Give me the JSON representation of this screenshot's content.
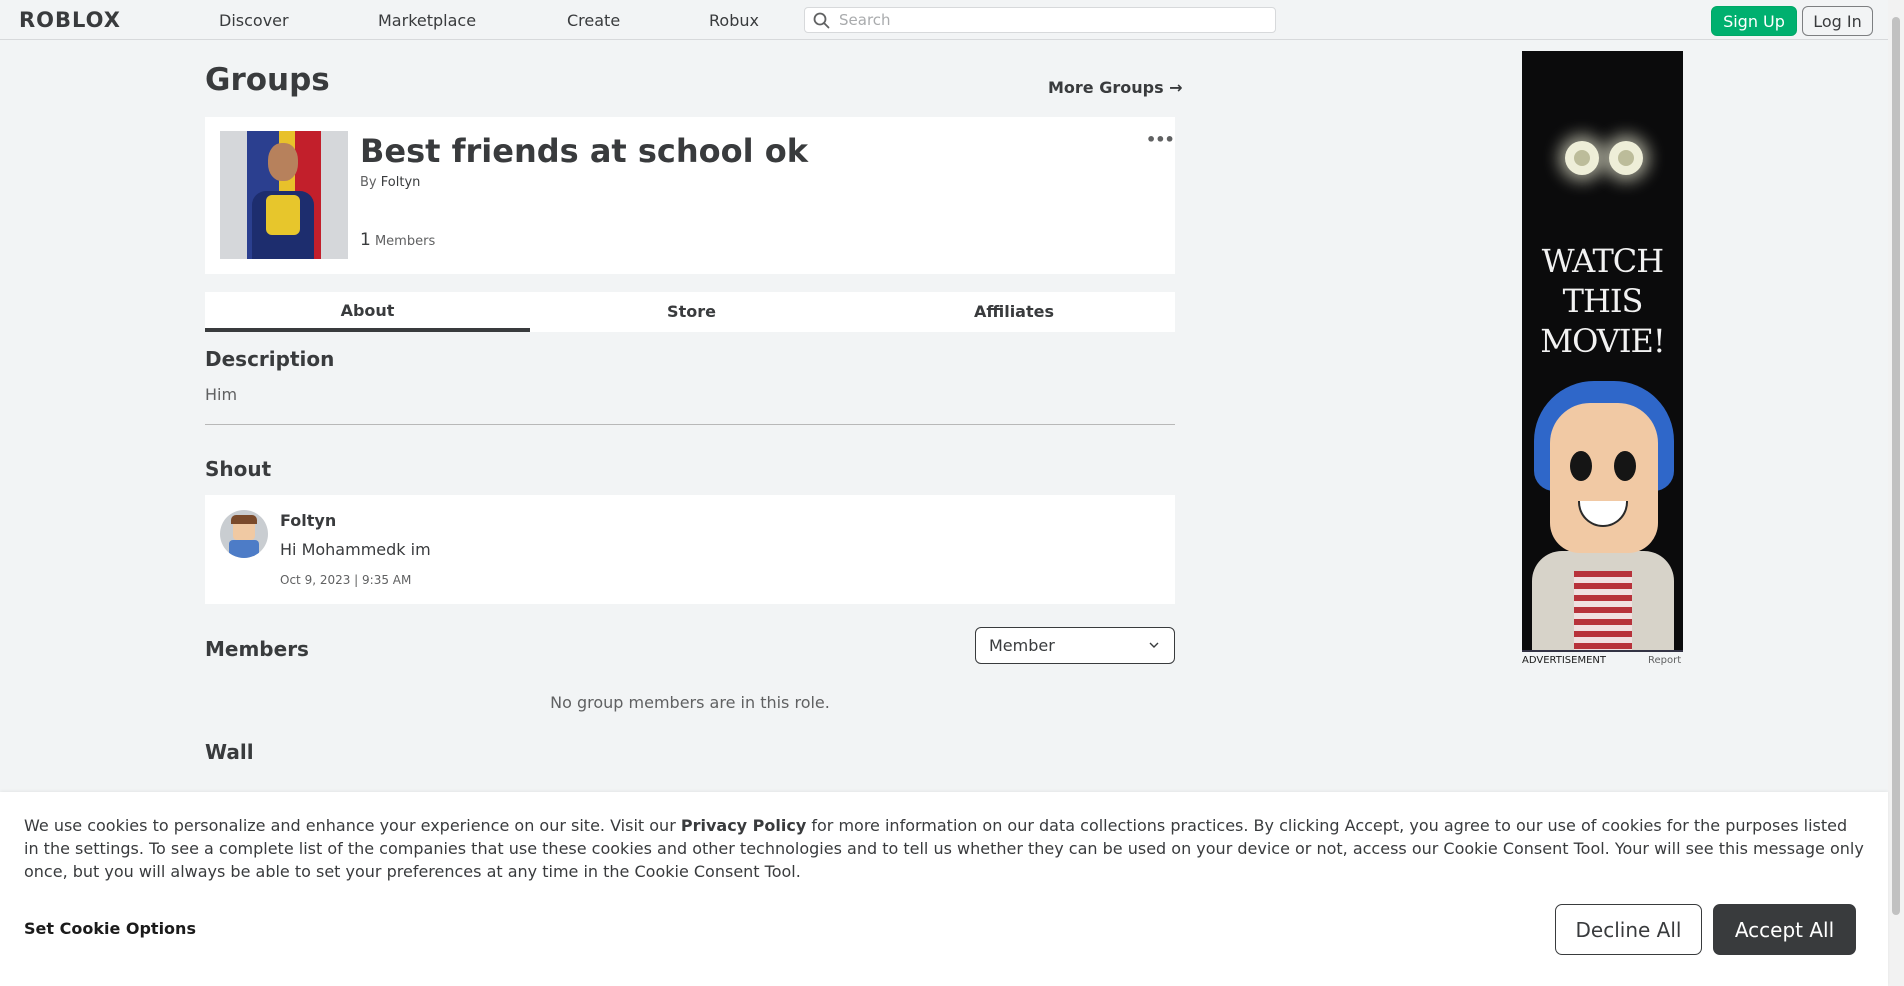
{
  "header": {
    "logo": "ROBLOX",
    "nav": [
      "Discover",
      "Marketplace",
      "Create",
      "Robux"
    ],
    "search_placeholder": "Search",
    "signup_label": "Sign Up",
    "login_label": "Log In"
  },
  "page": {
    "title": "Groups",
    "more_groups": "More Groups →"
  },
  "group": {
    "name": "Best friends at school ok",
    "by_prefix": "By",
    "owner": "Foltyn",
    "member_count": "1",
    "members_label": "Members",
    "more_menu": "•••"
  },
  "tabs": [
    "About",
    "Store",
    "Affiliates"
  ],
  "about": {
    "description_heading": "Description",
    "description_text": "Him",
    "shout_heading": "Shout",
    "shout": {
      "user": "Foltyn",
      "message": "Hi Mohammedk im",
      "date": "Oct 9, 2023 | 9:35 AM"
    },
    "members_heading": "Members",
    "role_selected": "Member",
    "no_members_text": "No group members are in this role.",
    "wall_heading": "Wall"
  },
  "ad": {
    "headline": "WATCH THIS MOVIE!",
    "label": "ADVERTISEMENT",
    "report": "Report"
  },
  "cookie": {
    "text_1": "We use cookies to personalize and enhance your experience on our site. Visit our ",
    "privacy_link": "Privacy Policy",
    "text_2": " for more information on our data collections practices. By clicking Accept, you agree to our use of cookies for the purposes listed in the settings. To see a complete list of the companies that use these cookies and other technologies and to tell us whether they can be used on your device or not, access our Cookie Consent Tool. Your will see this message only once, but you will always be able to set your preferences at any time in the Cookie Consent Tool.",
    "options_label": "Set Cookie Options",
    "decline_label": "Decline All",
    "accept_label": "Accept All"
  },
  "colors": {
    "background": "#f2f4f5",
    "text": "#393b3d",
    "signup_green": "#00b06f",
    "accept_dark": "#393b3d"
  }
}
